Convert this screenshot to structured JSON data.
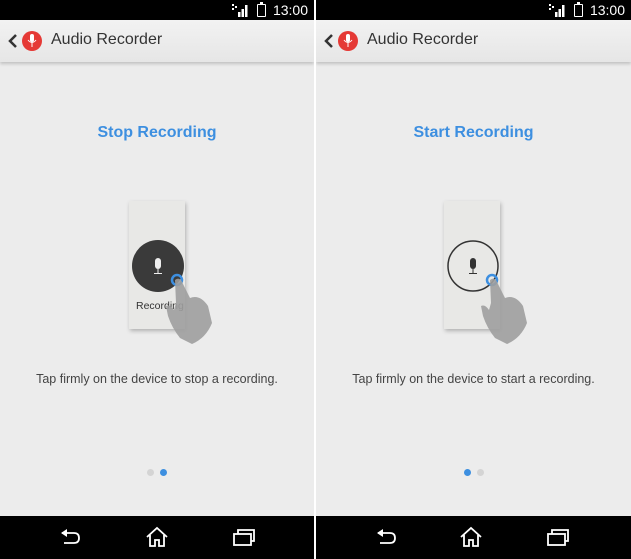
{
  "screens": [
    {
      "status_bar": {
        "time": "13:00"
      },
      "app_bar": {
        "title": "Audio Recorder",
        "icon": "microphone-icon"
      },
      "heading": "Stop Recording",
      "illustration": {
        "state": "recording",
        "label": "Recording"
      },
      "instruction": "Tap firmly on the device to stop a recording.",
      "pager": {
        "total": 2,
        "active_index": 1
      }
    },
    {
      "status_bar": {
        "time": "13:00"
      },
      "app_bar": {
        "title": "Audio Recorder",
        "icon": "microphone-icon"
      },
      "heading": "Start Recording",
      "illustration": {
        "state": "idle",
        "label": ""
      },
      "instruction": "Tap firmly on the device to start a recording.",
      "pager": {
        "total": 2,
        "active_index": 0
      }
    }
  ],
  "nav_bar": {
    "buttons": [
      "back-icon",
      "home-icon",
      "recent-apps-icon"
    ]
  },
  "colors": {
    "accent": "#3d8fe0",
    "app_icon": "#e53935",
    "dark_button": "#3a3a3a"
  }
}
